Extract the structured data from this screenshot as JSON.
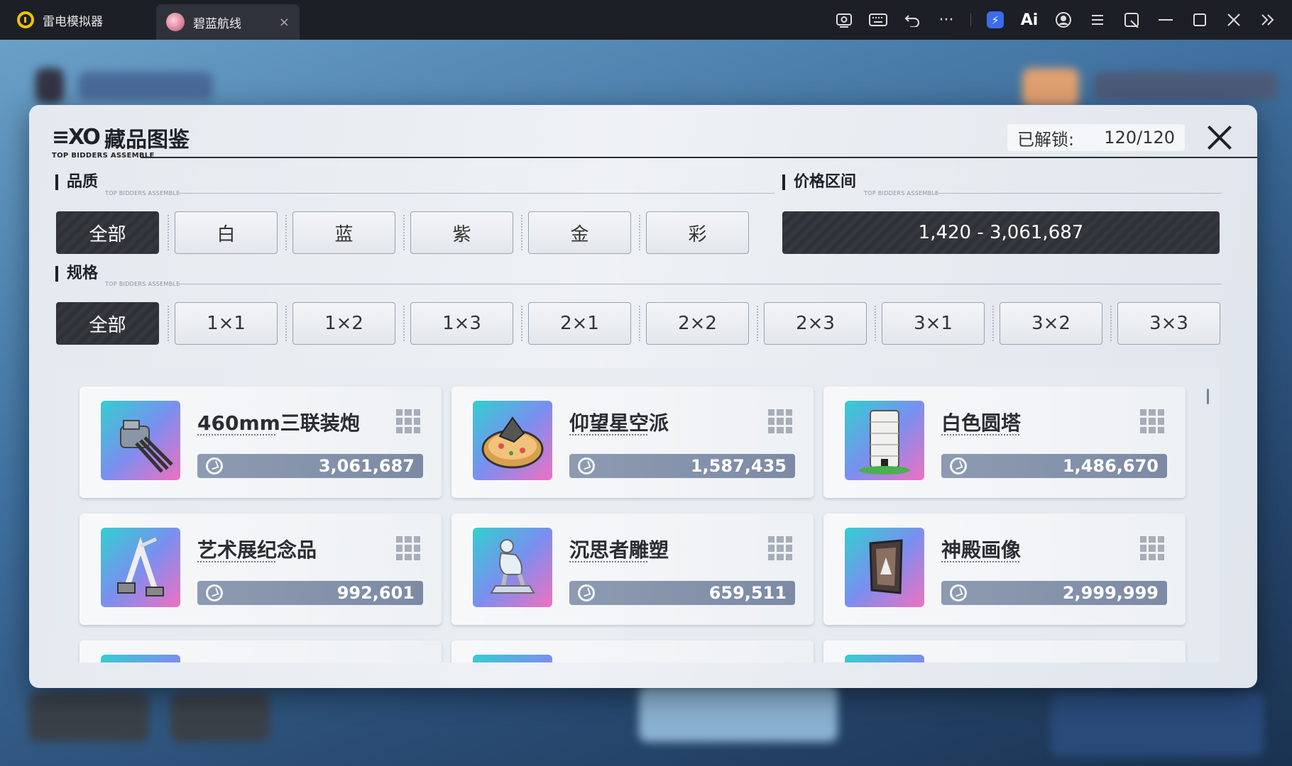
{
  "titlebar": {
    "app_name": "雷电模拟器",
    "tab_title": "碧蓝航线",
    "tab_close": "×",
    "tools": [
      "screenshot-icon",
      "keyboard-icon",
      "undo-icon",
      "more-icon",
      "bolt-icon",
      "ai-icon",
      "account-icon",
      "menu-icon",
      "popout-icon",
      "minimize-icon",
      "maximize-icon",
      "close-icon",
      "expand-icon"
    ],
    "ai_label": "Ai",
    "more_label": "···"
  },
  "modal": {
    "brand": "≡XO",
    "title": "藏品图鉴",
    "subtitle": "TOP BIDDERS ASSEMBLE",
    "unlocked_label": "已解锁:",
    "unlocked_value": "120/120"
  },
  "quality": {
    "title": "品质",
    "tag": "TOP BIDDERS ASSEMBLE",
    "options": [
      "全部",
      "白",
      "蓝",
      "紫",
      "金",
      "彩"
    ],
    "selected": "全部"
  },
  "price_range": {
    "title": "价格区间",
    "tag": "TOP BIDDERS ASSEMBLE",
    "value": "1,420 - 3,061,687"
  },
  "spec": {
    "title": "规格",
    "tag": "TOP BIDDERS ASSEMBLE",
    "options": [
      "全部",
      "1×1",
      "1×2",
      "1×3",
      "2×1",
      "2×2",
      "2×3",
      "3×1",
      "3×2",
      "3×3"
    ],
    "selected": "全部"
  },
  "items": [
    {
      "name": "460mm三联装炮",
      "price": "3,061,687",
      "icon": "cannon-icon"
    },
    {
      "name": "仰望星空派",
      "price": "1,587,435",
      "icon": "pie-icon"
    },
    {
      "name": "白色圆塔",
      "price": "1,486,670",
      "icon": "tower-icon"
    },
    {
      "name": "艺术展纪念品",
      "price": "992,601",
      "icon": "sculpture-icon"
    },
    {
      "name": "沉思者雕塑",
      "price": "659,511",
      "icon": "thinker-statue-icon"
    },
    {
      "name": "神殿画像",
      "price": "2,999,999",
      "icon": "painting-icon"
    }
  ],
  "colors": {
    "titlebar": "#1d1f26",
    "active_button": "#2e3136",
    "price_bar": "#8d9bb2"
  }
}
